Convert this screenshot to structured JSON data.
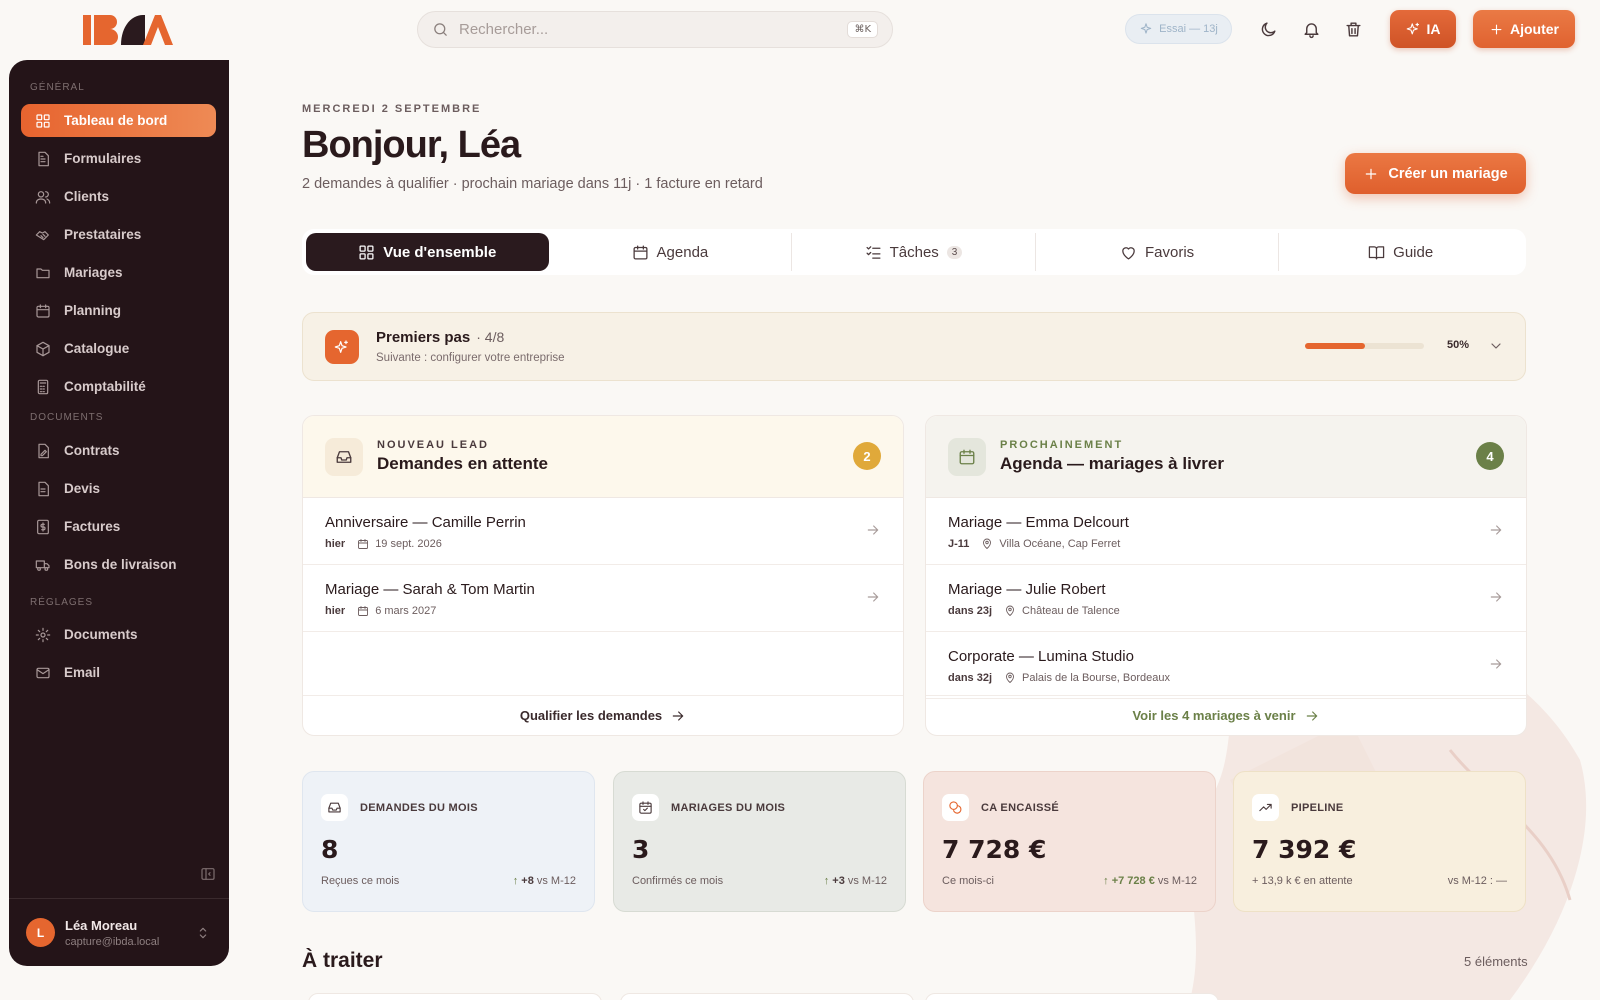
{
  "header": {
    "search_placeholder": "Rechercher...",
    "search_shortcut": "⌘K",
    "trial_label": "Essai — 13j",
    "ia_label": "IA",
    "add_label": "Ajouter"
  },
  "sidebar": {
    "section_general": "GÉNÉRAL",
    "section_documents": "DOCUMENTS",
    "section_settings": "RÉGLAGES",
    "items": [
      {
        "label": "Tableau de bord",
        "icon": "dashboard-icon"
      },
      {
        "label": "Formulaires",
        "icon": "form-icon"
      },
      {
        "label": "Clients",
        "icon": "users-icon"
      },
      {
        "label": "Prestataires",
        "icon": "handshake-icon"
      },
      {
        "label": "Mariages",
        "icon": "folder-icon"
      },
      {
        "label": "Planning",
        "icon": "calendar-icon"
      },
      {
        "label": "Catalogue",
        "icon": "box-icon"
      },
      {
        "label": "Comptabilité",
        "icon": "calculator-icon"
      },
      {
        "label": "Contrats",
        "icon": "contract-icon"
      },
      {
        "label": "Devis",
        "icon": "quote-icon"
      },
      {
        "label": "Factures",
        "icon": "invoice-icon"
      },
      {
        "label": "Bons de livraison",
        "icon": "truck-icon"
      },
      {
        "label": "Documents",
        "icon": "gear-icon"
      },
      {
        "label": "Email",
        "icon": "mail-icon"
      }
    ],
    "user": {
      "initial": "L",
      "name": "Léa Moreau",
      "email": "capture@ibda.local"
    }
  },
  "main": {
    "date": "MERCREDI 2 SEPTEMBRE",
    "greeting": "Bonjour, Léa",
    "summary": "2 demandes à qualifier · prochain mariage dans 11j · 1 facture en retard",
    "create_label": "Créer un mariage",
    "tabs": [
      {
        "label": "Vue d'ensemble"
      },
      {
        "label": "Agenda"
      },
      {
        "label": "Tâches",
        "count": "3"
      },
      {
        "label": "Favoris"
      },
      {
        "label": "Guide"
      }
    ],
    "onboarding": {
      "title": "Premiers pas",
      "progress_text": "· 4/8",
      "next": "Suivante : configurer votre entreprise",
      "percent_label": "50%",
      "progress": 0.5
    },
    "leads": {
      "kicker": "NOUVEAU LEAD",
      "title": "Demandes en attente",
      "count": "2",
      "rows": [
        {
          "title": "Anniversaire — Camille Perrin",
          "when": "hier",
          "date": "19 sept. 2026"
        },
        {
          "title": "Mariage — Sarah & Tom Martin",
          "when": "hier",
          "date": "6 mars 2027"
        }
      ],
      "footer": "Qualifier les demandes"
    },
    "agenda": {
      "kicker": "PROCHAINEMENT",
      "title": "Agenda — mariages à livrer",
      "count": "4",
      "rows": [
        {
          "title": "Mariage — Emma Delcourt",
          "when": "J-11",
          "place": "Villa Océane, Cap Ferret"
        },
        {
          "title": "Mariage — Julie Robert",
          "when": "dans 23j",
          "place": "Château de Talence"
        },
        {
          "title": "Corporate — Lumina Studio",
          "when": "dans 32j",
          "place": "Palais de la Bourse, Bordeaux"
        }
      ],
      "footer": "Voir les 4 mariages à venir"
    },
    "stats": [
      {
        "label": "DEMANDES DU MOIS",
        "value": "8",
        "sub": "Reçues ce mois",
        "delta": "+8",
        "cmp": "vs M-12",
        "icon": "inbox-icon"
      },
      {
        "label": "MARIAGES DU MOIS",
        "value": "3",
        "sub": "Confirmés ce mois",
        "delta": "+3",
        "cmp": "vs M-12",
        "icon": "calendar-check-icon"
      },
      {
        "label": "CA ENCAISSÉ",
        "value": "7 728 €",
        "sub": "Ce mois-ci",
        "delta": "+7 728 €",
        "cmp": "vs M-12",
        "icon": "coins-icon"
      },
      {
        "label": "PIPELINE",
        "value": "7 392 €",
        "sub": "+ 13,9 k € en attente",
        "delta": "",
        "cmp": "vs M-12 : —",
        "icon": "trending-up-icon"
      }
    ],
    "todo_title": "À traiter",
    "todo_count": "5 éléments"
  },
  "colors": {
    "accent": "#e5662f",
    "sidebar": "#241418",
    "gold": "#e0a93a",
    "olive": "#6b8048"
  }
}
